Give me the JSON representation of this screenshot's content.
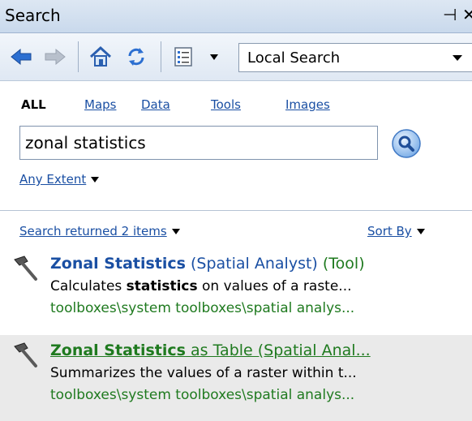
{
  "window": {
    "title": "Search",
    "pin_icon": "pin-icon",
    "close_icon": "close-icon"
  },
  "toolbar": {
    "back_icon": "back-arrow-icon",
    "forward_icon": "forward-arrow-icon",
    "home_icon": "home-icon",
    "refresh_icon": "refresh-icon",
    "options_icon": "list-options-icon",
    "search_location": "Local Search"
  },
  "categories": [
    {
      "label": "ALL",
      "active": true
    },
    {
      "label": "Maps",
      "active": false
    },
    {
      "label": "Data",
      "active": false
    },
    {
      "label": "Tools",
      "active": false
    },
    {
      "label": "Images",
      "active": false
    }
  ],
  "search": {
    "query": "zonal statistics",
    "button_icon": "magnifier-icon"
  },
  "extent": {
    "label": "Any Extent"
  },
  "results_header": {
    "count_label": "Search returned 2 items",
    "sort_label": "Sort By"
  },
  "results": [
    {
      "title_bold": "Zonal Statistics",
      "title_rest": " (Spatial Analyst) ",
      "title_type": "(Tool)",
      "desc_pre": "Calculates ",
      "desc_bold": "statistics",
      "desc_post": " on values of a raste...",
      "path": "toolboxes\\system toolboxes\\spatial analys..."
    },
    {
      "title_bold": "Zonal Statistics",
      "title_rest": " as Table (Spatial Anal...",
      "desc": "Summarizes the values of a raster within t...",
      "path": "toolboxes\\system toolboxes\\spatial analys..."
    }
  ],
  "colors": {
    "link": "#1a4fa3",
    "path_green": "#1f7a1f",
    "titlebar": "#c9d9ec"
  }
}
